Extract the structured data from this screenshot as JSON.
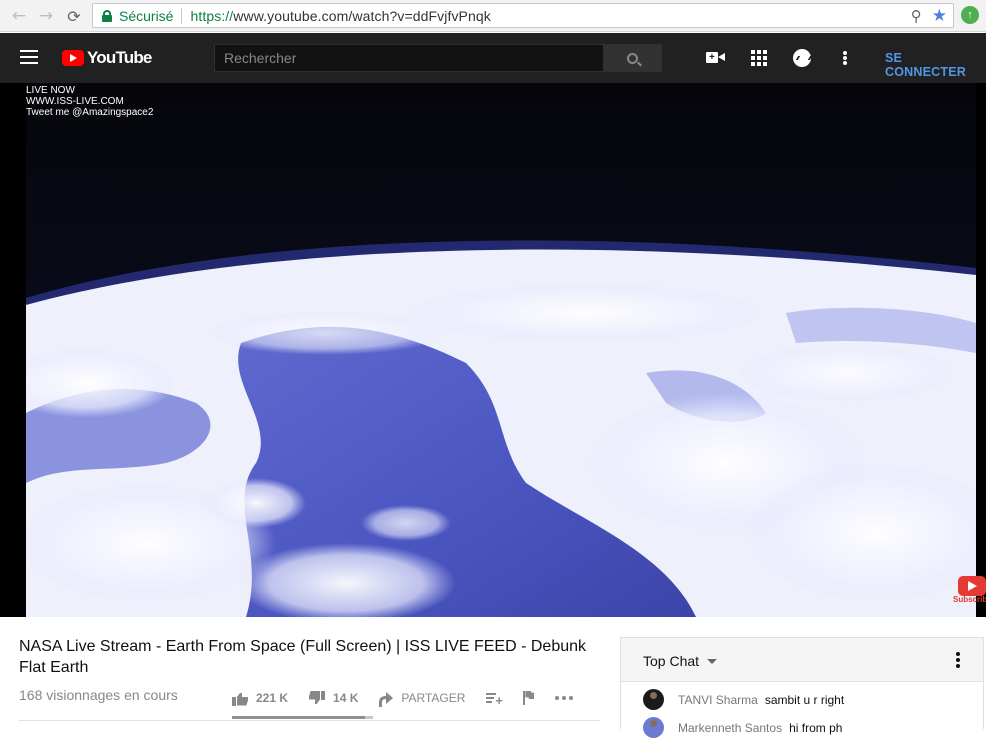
{
  "browser": {
    "back_glyph": "←",
    "forward_glyph": "→",
    "reload_glyph": "⟳",
    "secure_label": "Sécurisé",
    "url_scheme": "https://",
    "url_rest": "www.youtube.com/watch?v=ddFvjfvPnqk",
    "zoom_glyph": "⚲",
    "bookmark_glyph": "★",
    "extension_glyph": "↑"
  },
  "header": {
    "logo_text": "YouTube",
    "search_placeholder": "Rechercher",
    "signin_label": "SE CONNECTER"
  },
  "video": {
    "overlay_lines": [
      "LIVE NOW",
      "WWW.ISS-LIVE.COM",
      "Tweet me @Amazingspace2"
    ],
    "subscribe_label": "Subscribe"
  },
  "info": {
    "title": "NASA Live Stream - Earth From Space (Full Screen) | ISS LIVE FEED - Debunk Flat Earth",
    "views": "168 visionnages en cours",
    "likes": "221 K",
    "dislikes": "14 K",
    "share_label": "PARTAGER",
    "like_ratio": 0.94
  },
  "chat": {
    "title": "Top Chat",
    "messages": [
      {
        "author": "TANVI Sharma",
        "text": "sambit u r right"
      },
      {
        "author": "Markenneth Santos",
        "text": "hi from ph"
      }
    ]
  },
  "colors": {
    "header_bg": "#212121",
    "brand_red": "#ff0000",
    "signin_blue": "#4f97e8",
    "secure_green": "#0b8043"
  }
}
